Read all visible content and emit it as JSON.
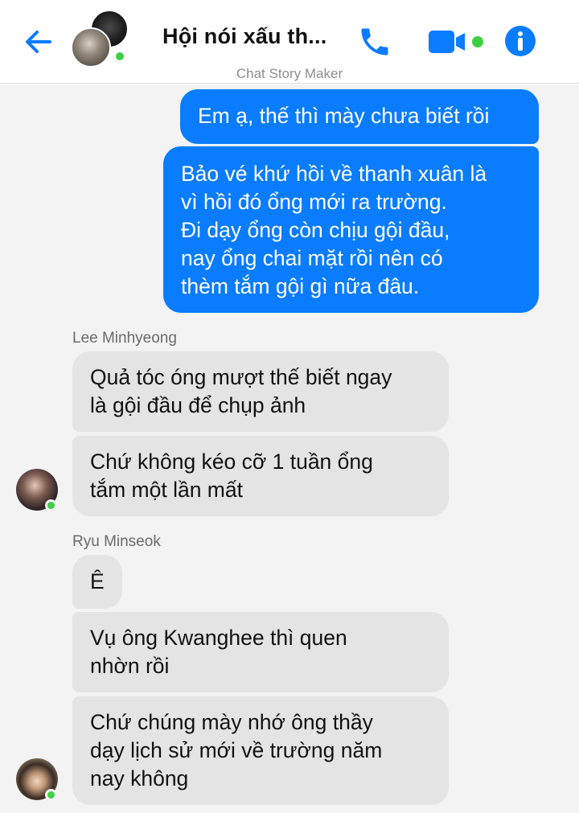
{
  "header": {
    "title": "Hội nói xấu th...",
    "watermark": "Chat Story Maker",
    "back_icon": "arrow-left-icon",
    "call_icon": "phone-icon",
    "video_icon": "video-camera-icon",
    "info_icon": "info-icon",
    "accent_color": "#0a7cff",
    "online_color": "#3fcf43"
  },
  "messages": [
    {
      "from": "me",
      "text": "Em ạ, thế thì mày chưa biết rồi"
    },
    {
      "from": "me",
      "text": "Bảo vé khứ hồi về thanh xuân là\nvì hồi đó ổng mới ra trường.\nĐi dạy ổng còn chịu gội đầu,\nnay ổng chai mặt rồi nên có\nthèm tắm gội gì nữa đâu."
    },
    {
      "from": "Lee Minhyeong",
      "sender_label": "Lee Minhyeong",
      "text": "Quả tóc óng mượt thế biết ngay\nlà gội đầu để chụp ảnh"
    },
    {
      "from": "Lee Minhyeong",
      "text": "Chứ không kéo cỡ 1 tuần ổng\ntắm một lần mất"
    },
    {
      "from": "Ryu Minseok",
      "sender_label": "Ryu Minseok",
      "text": "Ê"
    },
    {
      "from": "Ryu Minseok",
      "text": "Vụ ông Kwanghee thì quen\nnhờn rồi"
    },
    {
      "from": "Ryu Minseok",
      "text": "Chứ chúng mày nhớ ông thầy\ndạy lịch sử mới về trường năm\nnay không"
    }
  ],
  "colors": {
    "my_bubble": "#0a7cff",
    "their_bubble": "#e4e4e4",
    "chat_background": "#f3f3f3"
  }
}
